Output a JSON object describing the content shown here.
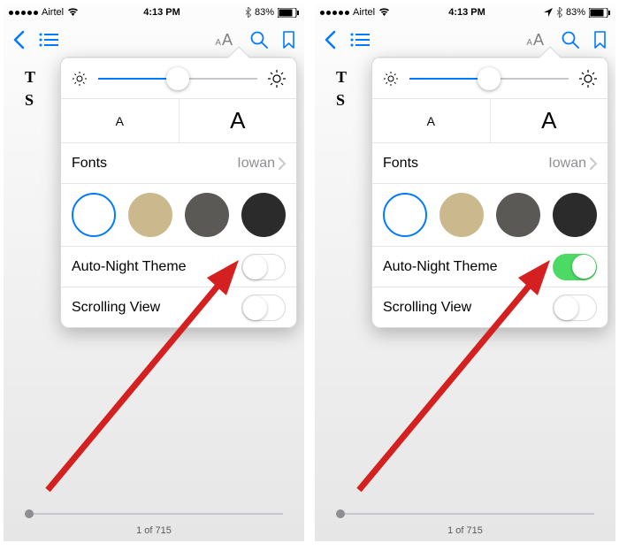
{
  "statusbar": {
    "carrier": "Airtel",
    "time": "4:13 PM",
    "battery_pct": "83%"
  },
  "content": {
    "line1": "T",
    "line2": "S"
  },
  "panel": {
    "fonts_label": "Fonts",
    "font_name": "Iowan",
    "fontsize_small": "A",
    "fontsize_large": "A",
    "auto_night": "Auto-Night Theme",
    "scrolling_view": "Scrolling View",
    "brightness_value_pct": 50,
    "themes": [
      "white",
      "sepia",
      "gray",
      "night"
    ]
  },
  "pager": {
    "text": "1 of 715"
  },
  "screens": [
    {
      "auto_night_on": false,
      "show_location_icon": false
    },
    {
      "auto_night_on": true,
      "show_location_icon": true
    }
  ],
  "colors": {
    "tint": "#007aff",
    "toggle_on": "#4cd964",
    "sepia": "#cbb98d",
    "gray": "#5a5956",
    "night": "#2b2b2b",
    "arrow": "#d42020"
  }
}
